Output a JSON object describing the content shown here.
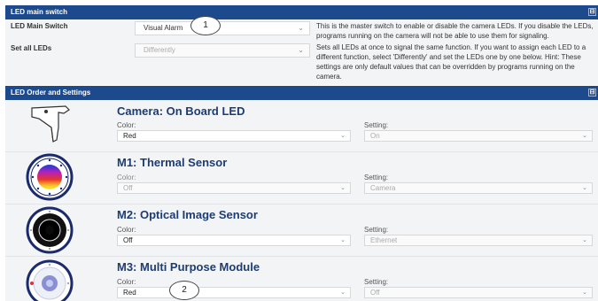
{
  "main_switch": {
    "header": "LED main switch",
    "rows": [
      {
        "label": "LED Main Switch",
        "value": "Visual Alarm",
        "help": "This is the master switch to enable or disable the camera LEDs. If you disable the LEDs, programs running on the camera will not be able to use them for signaling."
      },
      {
        "label": "Set all LEDs",
        "value": "Differently",
        "help": "Sets all LEDs at once to signal the same function. If you want to assign each LED to a different function, select 'Differently' and set the LEDs one by one below. Hint: These settings are only default values that can be overridden by programs running on the camera."
      }
    ]
  },
  "led_settings": {
    "header": "LED Order and Settings",
    "color_label": "Color:",
    "setting_label": "Setting:",
    "leds": [
      {
        "title": "Camera: On Board LED",
        "color": "Red",
        "setting": "On",
        "icon": "camera-mount-icon"
      },
      {
        "title": "M1: Thermal Sensor",
        "color": "Off",
        "setting": "Camera",
        "icon": "thermal-sensor-icon"
      },
      {
        "title": "M2: Optical Image Sensor",
        "color": "Off",
        "setting": "Ethernet",
        "icon": "optical-sensor-icon"
      },
      {
        "title": "M3: Multi Purpose Module",
        "color": "Red",
        "setting": "Off",
        "icon": "multi-purpose-module-icon"
      }
    ]
  },
  "callouts": [
    "1",
    "2"
  ],
  "collapse_glyph": "⊟",
  "chevron_glyph": "⌄"
}
